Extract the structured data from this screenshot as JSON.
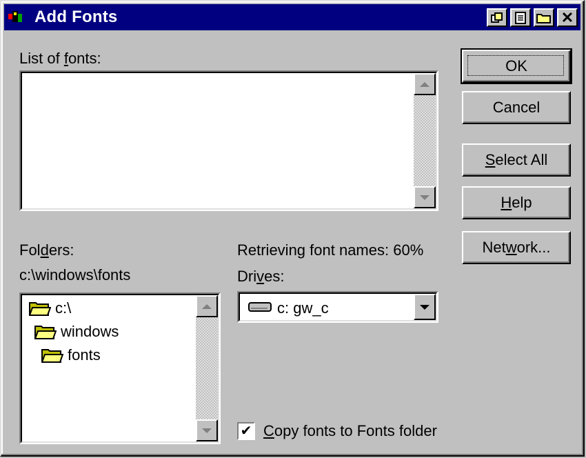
{
  "window": {
    "title": "Add Fonts",
    "controls": [
      "tile-icon",
      "document-icon",
      "folder-icon",
      "close-icon"
    ],
    "close_glyph": "✕"
  },
  "fonts_list": {
    "label_pre": "List of ",
    "label_accel": "f",
    "label_post": "onts:",
    "items": []
  },
  "folders": {
    "label_pre": "Fol",
    "label_accel": "d",
    "label_post": "ers:",
    "current_path": "c:\\windows\\fonts",
    "tree": [
      {
        "name": "c:\\",
        "open": true
      },
      {
        "name": "windows",
        "open": true
      },
      {
        "name": "fonts",
        "open": true
      }
    ]
  },
  "status": {
    "text": "Retrieving font names: 60%",
    "progress_percent": 60
  },
  "drives": {
    "label_pre": "Dri",
    "label_accel": "v",
    "label_post": "es:",
    "selected": "c: gw_c"
  },
  "copy_checkbox": {
    "checked": true,
    "check_glyph": "✔",
    "label_accel": "C",
    "label_post": "opy fonts to Fonts folder"
  },
  "buttons": {
    "ok": "OK",
    "cancel": "Cancel",
    "select_all_accel": "S",
    "select_all_post": "elect All",
    "help_accel": "H",
    "help_post": "elp",
    "network_pre": "Net",
    "network_accel": "w",
    "network_post": "ork..."
  },
  "colors": {
    "titlebar": "#000080",
    "face": "#c0c0c0",
    "folder_yellow": "#ffff80"
  }
}
